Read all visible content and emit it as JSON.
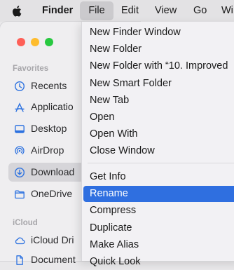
{
  "menubar": {
    "apple_icon": "apple-logo-icon",
    "items": [
      "Finder",
      "File",
      "Edit",
      "View",
      "Go",
      "Wi"
    ]
  },
  "window": {
    "traffic_lights": {
      "close": "#fe5f57",
      "minimize": "#febc2e",
      "zoom": "#28c840"
    }
  },
  "sidebar": {
    "favorites_heading": "Favorites",
    "favorites": [
      {
        "label": "Recents",
        "icon": "clock-icon"
      },
      {
        "label": "Applicatio",
        "icon": "applications-icon"
      },
      {
        "label": "Desktop",
        "icon": "desktop-icon"
      },
      {
        "label": "AirDrop",
        "icon": "airdrop-icon"
      },
      {
        "label": "Download",
        "icon": "downloads-icon",
        "selected": true
      },
      {
        "label": "OneDrive",
        "icon": "folder-icon"
      }
    ],
    "icloud_heading": "iCloud",
    "icloud": [
      {
        "label": "iCloud Dri",
        "icon": "cloud-icon"
      },
      {
        "label": "Document",
        "icon": "document-icon"
      }
    ]
  },
  "file_menu": {
    "group1": [
      "New Finder Window",
      "New Folder",
      "New Folder with “10. Improved",
      "New Smart Folder",
      "New Tab",
      "Open",
      "Open With",
      "Close Window"
    ],
    "group2": [
      "Get Info",
      "Rename",
      "Compress",
      "Duplicate",
      "Make Alias",
      "Quick Look"
    ],
    "highlighted": "Rename",
    "highlight_color": "#2f6fe0"
  }
}
